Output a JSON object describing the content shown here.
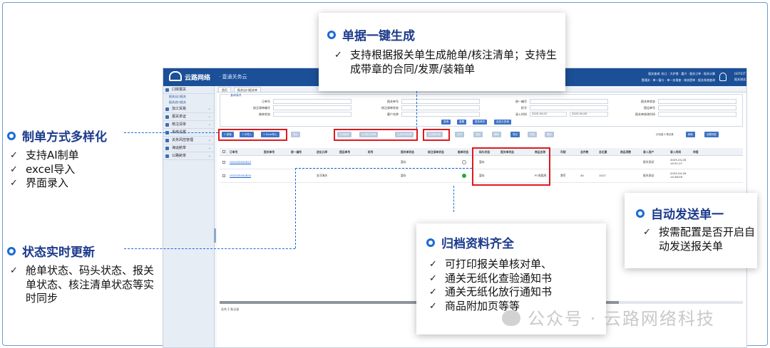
{
  "app": {
    "brand": "云路网络",
    "brand_sub": "· 壹通关务云",
    "header_info_line1": "报关查询: 松江 · 大护港 · 嘉兴 · 报关订单 · 报关计算",
    "header_info_line2": "壹通关 · 单一窗口 · 单一关境查 · 海关提单 · 报关系统查询",
    "user_line1": "GO7E1T",
    "user_line2": "报关测试",
    "sidebar": [
      {
        "label": "口岸报关",
        "subs": [
          "报关出口报关",
          "报关进口报关"
        ]
      },
      {
        "label": "加工贸易"
      },
      {
        "label": "报关单证"
      },
      {
        "label": "核注清单"
      },
      {
        "label": "系统设置"
      },
      {
        "label": "关务风控管理"
      },
      {
        "label": "海运舱单"
      },
      {
        "label": "公路舱单"
      }
    ],
    "tabs": [
      "首页",
      "报关出口报关单"
    ],
    "query_legend": "查询条件",
    "query_fields": [
      {
        "label": "订单号",
        "value": ""
      },
      {
        "label": "报关单号",
        "value": ""
      },
      {
        "label": "统一编号",
        "value": ""
      },
      {
        "label": "报关单状态",
        "value": ""
      },
      {
        "label": "核注清单编号",
        "value": ""
      },
      {
        "label": "核注清单状态",
        "value": ""
      },
      {
        "label": "柜号",
        "value": ""
      },
      {
        "label": "提运单号",
        "value": ""
      },
      {
        "label": "舱单状态",
        "value": ""
      },
      {
        "label": "客户名称",
        "value": ""
      },
      {
        "label": "录入时间",
        "value": "2025-04-25"
      },
      {
        "label": "报关单修改时间",
        "value": ""
      }
    ],
    "date_to": "2025-04-28",
    "query_buttons": [
      "查询",
      "重置",
      "更多条件",
      "自定义查询"
    ],
    "toolbar": [
      {
        "label": "+ 新增",
        "disabled": false
      },
      {
        "label": "+ AI导入",
        "disabled": false
      },
      {
        "label": "+ Excel导入",
        "disabled": false
      },
      {
        "label": "导出",
        "disabled": true
      },
      {
        "label": "生成舱单",
        "disabled": true
      },
      {
        "label": "生成核注清单",
        "disabled": true
      },
      {
        "label": "生成合同发票",
        "disabled": true
      },
      {
        "label": "生成报关单",
        "disabled": true
      },
      {
        "label": "打印",
        "disabled": true
      },
      {
        "label": "复制",
        "disabled": true
      },
      {
        "label": "删除",
        "disabled": true
      },
      {
        "label": "导出",
        "disabled": false
      },
      {
        "label": "归档",
        "disabled": true
      },
      {
        "label": "撤回",
        "disabled": true
      }
    ],
    "toolbar_right": [
      "已勾选 0 条记录",
      "刷新",
      "设置列宽"
    ],
    "table_columns": [
      "订单号",
      "报关单号",
      "统一编号",
      "进出口岸",
      "提运单号",
      "柜号",
      "报关单状态",
      "核注清单状态",
      "舱单状态",
      "码头状态",
      "报关单状态",
      "商品名称",
      "币制",
      "总件数",
      "总毛重",
      "商品项数",
      "录入用户",
      "录入时间",
      "申报"
    ],
    "rows": [
      {
        "order": "OG2025042813",
        "port": "",
        "status": "暂存",
        "dock": "暂存",
        "goods": "",
        "currency": "",
        "qty": "",
        "weight": "",
        "user": "报关测试",
        "time": "2025-04-28 14:51:27",
        "archived": false
      },
      {
        "order": "OG2025042820",
        "port": "金河海关",
        "status": "暂存",
        "dock": "暂存",
        "goods": "PC电阻线",
        "currency": "港币",
        "qty": "40",
        "weight": "1027",
        "user": "报关测试",
        "time": "2025-04-28 14:48:59",
        "archived": true
      }
    ],
    "footer": "总共 2 条记录"
  },
  "callouts": {
    "one_click": {
      "title": "单据一键生成",
      "items": [
        "支持根据报关单生成舱单/核注清单；支持生成带章的合同/发票/装箱单"
      ]
    },
    "multi_mode": {
      "title": "制单方式多样化",
      "items": [
        "支持AI制单",
        "excel导入",
        "界面录入"
      ]
    },
    "realtime": {
      "title": "状态实时更新",
      "items": [
        "舱单状态、码头状态、报关单状态、核注清单状态等实时同步"
      ]
    },
    "auto_send": {
      "title": "自动发送单一",
      "items": [
        "按需配置是否开启自动发送报关单"
      ]
    },
    "archive": {
      "title": "归档资料齐全",
      "items": [
        "可打印报关单核对单、",
        "通关无纸化查验通知书",
        "通关无纸化放行通知书",
        "商品附加页等等"
      ]
    }
  },
  "watermark": {
    "prefix": "公众号",
    "sep": "·",
    "name": "云路网络科技"
  },
  "colors": {
    "accent": "#1c6bd6",
    "title": "#1b3a8c",
    "highlight": "#e0191f",
    "header": "#1b4f97"
  }
}
